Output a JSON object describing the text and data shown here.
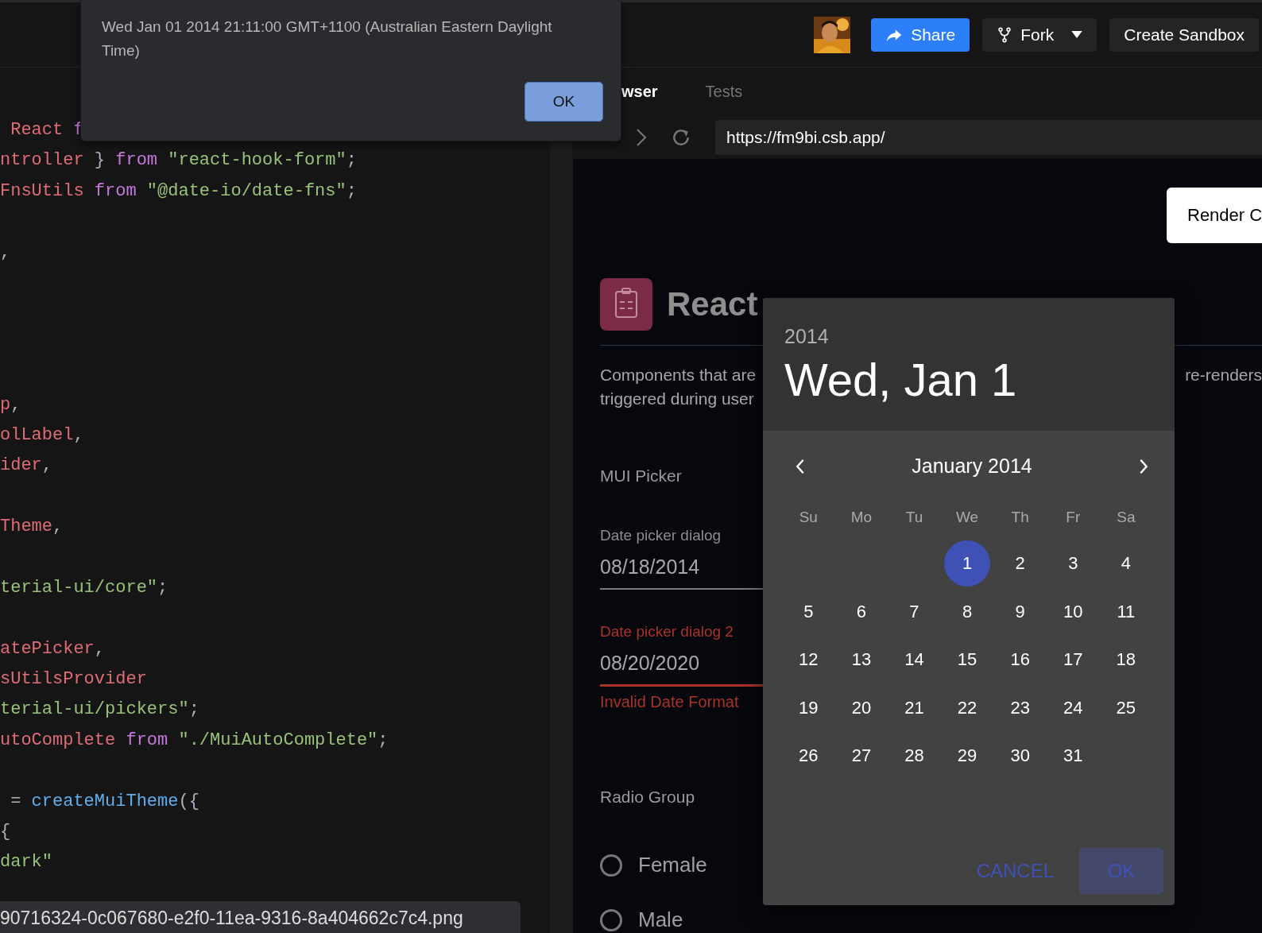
{
  "alert": {
    "message": "Wed Jan 01 2014 21:11:00 GMT+1100 (Australian Eastern Daylight Time)",
    "button": "OK"
  },
  "top_bar": {
    "buttons": [
      {
        "label": "Share",
        "kind": "primary"
      },
      {
        "label": "Fork",
        "kind": "dropdown"
      },
      {
        "label": "Create Sandbox",
        "kind": "plain"
      }
    ]
  },
  "editor": {
    "lines": [
      {
        "kind": "code",
        "tokens": [
          {
            "text": " React",
            "kind": "identifier"
          },
          {
            "text": " f",
            "kind": "keyword"
          }
        ]
      },
      {
        "kind": "code",
        "tokens": [
          {
            "text": "ntroller",
            "kind": "identifier"
          },
          {
            "text": " } ",
            "kind": "punct"
          },
          {
            "text": "from",
            "kind": "keyword"
          },
          {
            "text": " \"react-hook-form\"",
            "kind": "string"
          },
          {
            "text": ";",
            "kind": "punct"
          }
        ]
      },
      {
        "kind": "code",
        "tokens": [
          {
            "text": "FnsUtils",
            "kind": "identifier"
          },
          {
            "text": " from",
            "kind": "keyword"
          },
          {
            "text": " \"@date-io/date-fns\"",
            "kind": "string"
          },
          {
            "text": ";",
            "kind": "punct"
          }
        ]
      },
      {
        "kind": "blank"
      },
      {
        "kind": "code",
        "tokens": [
          {
            "text": ",",
            "kind": "punct"
          }
        ]
      },
      {
        "kind": "blank"
      },
      {
        "kind": "blank"
      },
      {
        "kind": "blank"
      },
      {
        "kind": "blank"
      },
      {
        "kind": "code",
        "tokens": [
          {
            "text": "p",
            "kind": "identifier"
          },
          {
            "text": ",",
            "kind": "punct"
          }
        ]
      },
      {
        "kind": "code",
        "tokens": [
          {
            "text": "olLabel",
            "kind": "identifier"
          },
          {
            "text": ",",
            "kind": "punct"
          }
        ]
      },
      {
        "kind": "code",
        "tokens": [
          {
            "text": "ider",
            "kind": "identifier"
          },
          {
            "text": ",",
            "kind": "punct"
          }
        ]
      },
      {
        "kind": "blank"
      },
      {
        "kind": "code",
        "tokens": [
          {
            "text": "Theme",
            "kind": "identifier"
          },
          {
            "text": ",",
            "kind": "punct"
          }
        ]
      },
      {
        "kind": "blank"
      },
      {
        "kind": "code",
        "tokens": [
          {
            "text": "terial-ui/core\"",
            "kind": "string"
          },
          {
            "text": ";",
            "kind": "punct"
          }
        ]
      },
      {
        "kind": "blank"
      },
      {
        "kind": "code",
        "tokens": [
          {
            "text": "atePicker",
            "kind": "identifier"
          },
          {
            "text": ",",
            "kind": "punct"
          }
        ]
      },
      {
        "kind": "code",
        "tokens": [
          {
            "text": "sUtilsProvider",
            "kind": "identifier"
          }
        ]
      },
      {
        "kind": "code",
        "tokens": [
          {
            "text": "terial-ui/pickers\"",
            "kind": "string"
          },
          {
            "text": ";",
            "kind": "punct"
          }
        ]
      },
      {
        "kind": "code",
        "tokens": [
          {
            "text": "utoComplete",
            "kind": "identifier"
          },
          {
            "text": " from",
            "kind": "keyword"
          },
          {
            "text": " \"./MuiAutoComplete\"",
            "kind": "string"
          },
          {
            "text": ";",
            "kind": "punct"
          }
        ]
      },
      {
        "kind": "blank"
      },
      {
        "kind": "code",
        "tokens": [
          {
            "text": " = ",
            "kind": "punct"
          },
          {
            "text": "createMuiTheme",
            "kind": "function"
          },
          {
            "text": "({",
            "kind": "punct"
          }
        ]
      },
      {
        "kind": "code",
        "tokens": [
          {
            "text": "{",
            "kind": "punct"
          }
        ]
      },
      {
        "kind": "code",
        "tokens": [
          {
            "text": "dark\"",
            "kind": "string"
          }
        ]
      }
    ]
  },
  "tooltip": "90716324-0c067680-e2f0-11ea-9316-8a404662c7c4.png",
  "preview": {
    "tabs": [
      {
        "label": "wser",
        "selected": true
      },
      {
        "label": "Tests",
        "selected": false
      }
    ],
    "url": "https://fm9bi.csb.app/",
    "render_button": "Render C",
    "title": "React",
    "description_left": [
      "Components that are",
      "triggered during user"
    ],
    "description_right": "re-renders",
    "section_label": "MUI Picker",
    "fields": [
      {
        "label": "Date picker dialog",
        "value": "08/18/2014",
        "error": false
      },
      {
        "label": "Date picker dialog 2",
        "value": "08/20/2020",
        "error": true,
        "helper": "Invalid Date Format"
      }
    ],
    "radio_group": {
      "label": "Radio Group",
      "options": [
        {
          "label": "Female",
          "checked": false
        },
        {
          "label": "Male",
          "checked": false
        }
      ]
    }
  },
  "date_dialog": {
    "year": "2014",
    "date": "Wed, Jan 1",
    "month": "January 2014",
    "weekdays": [
      "Su",
      "Mo",
      "Tu",
      "We",
      "Th",
      "Fr",
      "Sa"
    ],
    "weeks": [
      [
        {
          "kind": "empty"
        },
        {
          "kind": "empty"
        },
        {
          "kind": "empty"
        },
        {
          "kind": "day",
          "label": "1",
          "selected": true
        },
        {
          "kind": "day",
          "label": "2",
          "selected": false
        },
        {
          "kind": "day",
          "label": "3",
          "selected": false
        },
        {
          "kind": "day",
          "label": "4",
          "selected": false
        }
      ],
      [
        {
          "kind": "day",
          "label": "5",
          "selected": false
        },
        {
          "kind": "day",
          "label": "6",
          "selected": false
        },
        {
          "kind": "day",
          "label": "7",
          "selected": false
        },
        {
          "kind": "day",
          "label": "8",
          "selected": false
        },
        {
          "kind": "day",
          "label": "9",
          "selected": false
        },
        {
          "kind": "day",
          "label": "10",
          "selected": false
        },
        {
          "kind": "day",
          "label": "11",
          "selected": false
        }
      ],
      [
        {
          "kind": "day",
          "label": "12",
          "selected": false
        },
        {
          "kind": "day",
          "label": "13",
          "selected": false
        },
        {
          "kind": "day",
          "label": "14",
          "selected": false
        },
        {
          "kind": "day",
          "label": "15",
          "selected": false
        },
        {
          "kind": "day",
          "label": "16",
          "selected": false
        },
        {
          "kind": "day",
          "label": "17",
          "selected": false
        },
        {
          "kind": "day",
          "label": "18",
          "selected": false
        }
      ],
      [
        {
          "kind": "day",
          "label": "19",
          "selected": false
        },
        {
          "kind": "day",
          "label": "20",
          "selected": false
        },
        {
          "kind": "day",
          "label": "21",
          "selected": false
        },
        {
          "kind": "day",
          "label": "22",
          "selected": false
        },
        {
          "kind": "day",
          "label": "23",
          "selected": false
        },
        {
          "kind": "day",
          "label": "24",
          "selected": false
        },
        {
          "kind": "day",
          "label": "25",
          "selected": false
        }
      ],
      [
        {
          "kind": "day",
          "label": "26",
          "selected": false
        },
        {
          "kind": "day",
          "label": "27",
          "selected": false
        },
        {
          "kind": "day",
          "label": "28",
          "selected": false
        },
        {
          "kind": "day",
          "label": "29",
          "selected": false
        },
        {
          "kind": "day",
          "label": "30",
          "selected": false
        },
        {
          "kind": "day",
          "label": "31",
          "selected": false
        }
      ]
    ],
    "actions": [
      {
        "label": "CANCEL",
        "kind": "text"
      },
      {
        "label": "OK",
        "kind": "filled"
      }
    ]
  }
}
